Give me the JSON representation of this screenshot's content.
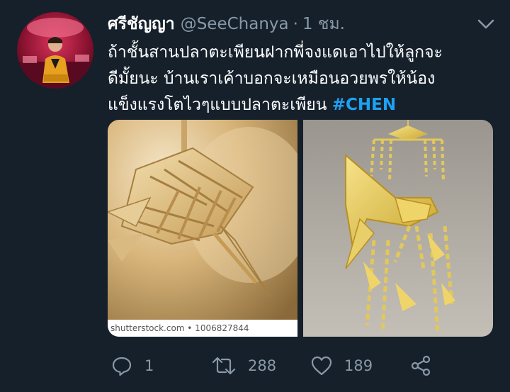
{
  "tweet": {
    "display_name": "ศรีชัญญา",
    "handle": "@SeeChanya",
    "separator": "·",
    "time": "1 ชม.",
    "text_lines": [
      "ถ้าชั้นสานปลาตะเพียนฝากพี่จงแดเอาไปให้ลูกจะ",
      "ดีมั้ยนะ บ้านเราเค้าบอกจะเหมือนอวยพรให้น้อง",
      "แข็งแรงโตไวๆแบบปลาตะเพียน"
    ],
    "hashtag": "#CHEN",
    "media": {
      "left_watermark": "shutterstock.com • 1006827844"
    },
    "actions": {
      "reply_count": "1",
      "retweet_count": "288",
      "like_count": "189"
    }
  },
  "icons": {
    "caret": "chevron-down-icon",
    "reply": "reply-icon",
    "retweet": "retweet-icon",
    "like": "heart-icon",
    "share": "share-icon"
  },
  "colors": {
    "background": "#15202b",
    "secondary_text": "#8899a6",
    "hashtag": "#1da1f2"
  }
}
